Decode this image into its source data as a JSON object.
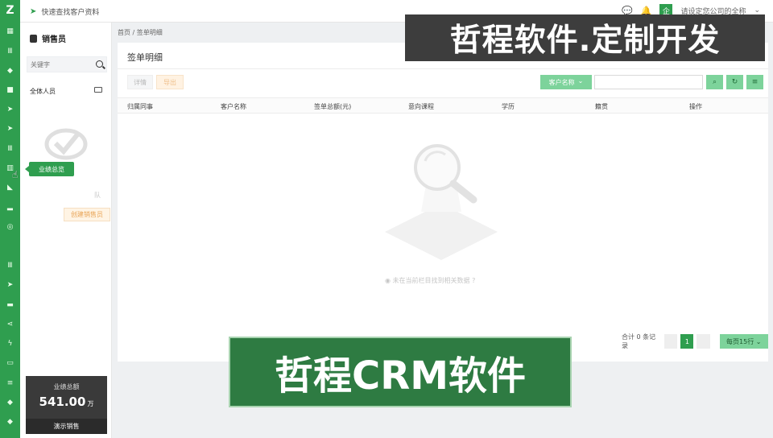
{
  "rail": {
    "logo": "Z",
    "items": [
      {
        "icon": "calendar-icon",
        "glyph": "▦"
      },
      {
        "icon": "bars-icon",
        "glyph": "Ⅲ"
      },
      {
        "icon": "bell-icon",
        "glyph": "◆"
      },
      {
        "icon": "video-icon",
        "glyph": "■"
      },
      {
        "icon": "send-icon",
        "glyph": "➤"
      },
      {
        "icon": "send-icon",
        "glyph": "➤"
      },
      {
        "icon": "bars-icon",
        "glyph": "Ⅲ"
      },
      {
        "icon": "chart-icon",
        "glyph": "▥"
      },
      {
        "icon": "tag-icon",
        "glyph": "◣"
      },
      {
        "icon": "signal-icon",
        "glyph": "▂"
      },
      {
        "icon": "target-icon",
        "glyph": "◎"
      },
      {
        "icon": "bars-icon",
        "glyph": "Ⅲ"
      },
      {
        "icon": "send-icon",
        "glyph": "➤"
      },
      {
        "icon": "folder-icon",
        "glyph": "▬"
      },
      {
        "icon": "share-icon",
        "glyph": "⋖"
      },
      {
        "icon": "bolt-icon",
        "glyph": "ϟ"
      },
      {
        "icon": "book-icon",
        "glyph": "▭"
      },
      {
        "icon": "list-icon",
        "glyph": "≡"
      },
      {
        "icon": "tag-icon",
        "glyph": "◆"
      },
      {
        "icon": "tag-icon",
        "glyph": "◆"
      },
      {
        "icon": "tag-icon",
        "glyph": "◆"
      }
    ]
  },
  "topbar": {
    "quick_search": "快速查找客户资料",
    "avatar_char": "企",
    "company": "请设定您公司的全称"
  },
  "sidebar": {
    "title": "销售员",
    "keyword_placeholder": "关键字",
    "all_staff": "全体人员",
    "tooltip": "业绩总览",
    "team_hint": "队",
    "create_button": "创建销售员",
    "performance": {
      "label": "业绩总额",
      "value": "541.00",
      "unit": "万",
      "footer": "演示销售"
    }
  },
  "main": {
    "breadcrumb": "首页 / 签单明细",
    "card_title": "签单明细",
    "toolbar": {
      "detail": "详情",
      "export": "导出",
      "field_select": "客户名称",
      "search_value": ""
    },
    "columns": [
      "归属同事",
      "客户名称",
      "签单总额(元)",
      "意向课程",
      "学历",
      "籍贯",
      "操作"
    ],
    "empty_text": "未在当前栏目找到相关数据",
    "pagination": {
      "total": "合计 0 条记录",
      "current_page": "1",
      "per_page": "每页15行"
    }
  },
  "overlays": {
    "watermark": "哲程软件.定制开发",
    "banner": "哲程CRM软件"
  }
}
